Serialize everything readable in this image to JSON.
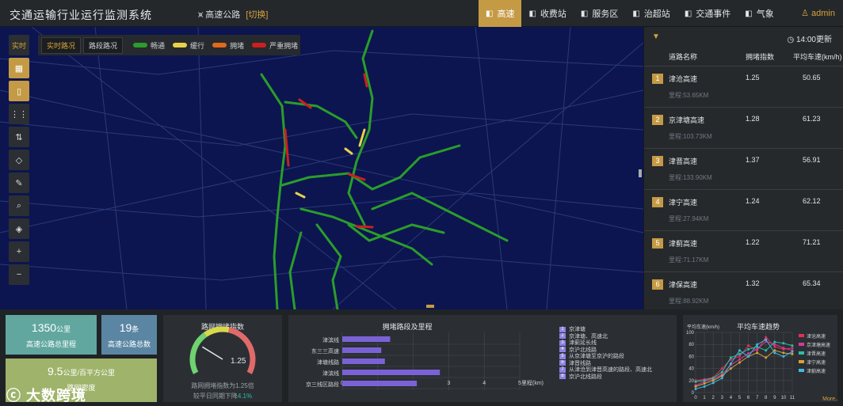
{
  "header": {
    "title": "交通运输行业运行监测系统",
    "road_label": "高速公路",
    "switch_label": "[切换]",
    "nav": [
      {
        "label": "高速",
        "icon": "highway-icon",
        "active": true
      },
      {
        "label": "收费站",
        "icon": "toll-icon",
        "active": false
      },
      {
        "label": "服务区",
        "icon": "service-icon",
        "active": false
      },
      {
        "label": "治超站",
        "icon": "overload-icon",
        "active": false
      },
      {
        "label": "交通事件",
        "icon": "event-icon",
        "active": false
      },
      {
        "label": "气象",
        "icon": "weather-icon",
        "active": false
      }
    ],
    "user": "admin"
  },
  "map": {
    "toolbar_first": "实时",
    "tab_realtime": "实时路况",
    "tab_section": "路段路况",
    "legend": [
      {
        "label": "畅通",
        "color": "#2a9d2a"
      },
      {
        "label": "缓行",
        "color": "#e8d24a"
      },
      {
        "label": "拥堵",
        "color": "#e06a1c"
      },
      {
        "label": "严重拥堵",
        "color": "#cc1f1f"
      }
    ],
    "tools": [
      "grid-icon",
      "phone-icon",
      "list-icon",
      "sort-icon",
      "eraser-icon",
      "ruler-icon",
      "search-icon",
      "layers-icon",
      "zoom-in-icon",
      "zoom-out-icon"
    ],
    "tool_glyphs": [
      "▦",
      "▯",
      "⋮⋮",
      "⇅",
      "◇",
      "✎",
      "⌕",
      "◈",
      "+",
      "−"
    ]
  },
  "panel": {
    "time": "14:00更新",
    "col_name": "道路名称",
    "col_index": "拥堵指数",
    "col_speed": "平均车速(km/h)",
    "rows": [
      {
        "rank": "1",
        "name": "津沧高速",
        "index": "1.25",
        "speed": "50.65",
        "mileage": "里程:53.65KM"
      },
      {
        "rank": "2",
        "name": "京津塘高速",
        "index": "1.28",
        "speed": "61.23",
        "mileage": "里程:103.73KM"
      },
      {
        "rank": "3",
        "name": "津晋高速",
        "index": "1.37",
        "speed": "56.91",
        "mileage": "里程:133.90KM"
      },
      {
        "rank": "4",
        "name": "津宁高速",
        "index": "1.24",
        "speed": "62.12",
        "mileage": "里程:27.94KM"
      },
      {
        "rank": "5",
        "name": "津蓟高速",
        "index": "1.22",
        "speed": "71.21",
        "mileage": "里程:71.17KM"
      },
      {
        "rank": "6",
        "name": "津保高速",
        "index": "1.32",
        "speed": "65.34",
        "mileage": "里程:88.92KM"
      }
    ]
  },
  "kpis": {
    "mileage_value": "1350",
    "mileage_unit": "公里",
    "mileage_label": "高速公路总里程",
    "count_value": "19",
    "count_unit": "条",
    "count_label": "高速公路总数",
    "density_value": "9.5",
    "density_unit": "公里/百平方公里",
    "density_label": "路网密度"
  },
  "gauge": {
    "title": "路网拥堵指数",
    "value": 1.25,
    "value_text": "1.25",
    "desc": "路网拥堵指数为1.25倍",
    "compare_prefix": "较平日同期下降",
    "compare_value": "4.1%"
  },
  "bars": {
    "title": "拥堵路段及里程",
    "unit_label": "里程(km)",
    "legend": [
      {
        "num": "1",
        "text": "京津塘"
      },
      {
        "num": "2",
        "text": "京津塘、高速北"
      },
      {
        "num": "3",
        "text": "津蓟延长线"
      },
      {
        "num": "4",
        "text": "京沪北线路"
      },
      {
        "num": "5",
        "text": "从京津塘至京沪的路段"
      },
      {
        "num": "6",
        "text": "津晋线路"
      },
      {
        "num": "7",
        "text": "从津沧到津晋高速的路段、高速北"
      },
      {
        "num": "8",
        "text": "京沪北线路段"
      }
    ]
  },
  "line_chart": {
    "title": "平均车速趋势"
  },
  "watermark": "大数跨境",
  "more": "More..",
  "chart_data": [
    {
      "type": "bar",
      "title": "拥堵路段及里程",
      "categories": [
        "津滨线",
        "东三三高速",
        "津塘线路",
        "津滨线",
        "京三线区路段"
      ],
      "values": [
        1.35,
        1.1,
        1.2,
        2.75,
        2.1
      ],
      "xlabel": "里程(km)",
      "xlim": [
        0,
        5
      ],
      "ticks": [
        0,
        1,
        2,
        3,
        4,
        5
      ],
      "color": "#7a62d6"
    },
    {
      "type": "line",
      "title": "平均车速趋势",
      "ylabel": "平均车速(km/h)",
      "x": [
        0,
        1,
        2,
        3,
        4,
        5,
        6,
        7,
        8,
        9,
        10,
        11
      ],
      "ylim": [
        0,
        100
      ],
      "yticks": [
        0,
        20,
        40,
        60,
        80,
        100
      ],
      "series": [
        {
          "name": "津沧高速",
          "color": "#e0305a",
          "values": [
            20,
            22,
            25,
            40,
            55,
            60,
            78,
            70,
            92,
            76,
            72,
            74
          ]
        },
        {
          "name": "京津塘高速",
          "color": "#d63a9a",
          "values": [
            12,
            18,
            22,
            30,
            46,
            55,
            65,
            72,
            85,
            80,
            74,
            70
          ]
        },
        {
          "name": "津晋高速",
          "color": "#2ac0a6",
          "values": [
            18,
            20,
            24,
            34,
            58,
            64,
            72,
            76,
            70,
            84,
            82,
            78
          ]
        },
        {
          "name": "津宁高速",
          "color": "#d5a23d",
          "values": [
            10,
            15,
            20,
            28,
            40,
            50,
            60,
            66,
            58,
            70,
            66,
            64
          ]
        },
        {
          "name": "津蓟高速",
          "color": "#42b8e6",
          "values": [
            6,
            10,
            16,
            24,
            48,
            70,
            60,
            80,
            88,
            66,
            60,
            68
          ]
        }
      ]
    }
  ]
}
